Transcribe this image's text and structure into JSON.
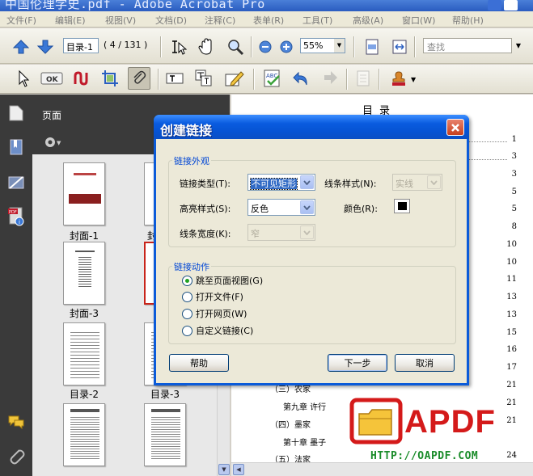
{
  "window": {
    "title": "中国伦理学史.pdf - Adobe Acrobat Pro"
  },
  "menu": [
    "文件(F)",
    "编辑(E)",
    "视图(V)",
    "文档(D)",
    "注释(C)",
    "表单(R)",
    "工具(T)",
    "高级(A)",
    "窗口(W)",
    "帮助(H)"
  ],
  "toolbar": {
    "page_field": "目录-1",
    "page_count": "( 4 / 131 )",
    "zoom": "55%",
    "search_placeholder": "查找"
  },
  "panel": {
    "title": "页面",
    "thumbnails": [
      "封面-1",
      "封",
      "封面-3",
      "",
      "目录-2",
      "目录-3",
      "",
      ""
    ]
  },
  "document": {
    "heading": "目录",
    "page_numbers": [
      "1",
      "3",
      "3",
      "5",
      "5",
      "8",
      "10",
      "10",
      "11",
      "13",
      "13",
      "15",
      "16",
      "17",
      "21",
      "21",
      "21",
      "24"
    ],
    "entries": [
      {
        "text": "（三）农家"
      },
      {
        "text": "第九章  许行"
      },
      {
        "text": "（四）墨家"
      },
      {
        "text": "第十章  墨子"
      },
      {
        "text": "（五）法家"
      }
    ],
    "watermark_brand": "APDF",
    "watermark_url": "HTTP://OAPDF.COM"
  },
  "dialog": {
    "title": "创建链接",
    "appearance_group": "链接外观",
    "link_type_label": "链接类型(T):",
    "link_type_value": "不可见矩形",
    "line_style_label": "线条样式(N):",
    "line_style_value": "实线",
    "highlight_label": "高亮样式(S):",
    "highlight_value": "反色",
    "color_label": "颜色(R):",
    "color_value": "#000000",
    "line_width_label": "线条宽度(K):",
    "line_width_value": "窄",
    "action_group": "链接动作",
    "actions": [
      {
        "label": "跳至页面视图(G)",
        "selected": true
      },
      {
        "label": "打开文件(F)",
        "selected": false
      },
      {
        "label": "打开网页(W)",
        "selected": false
      },
      {
        "label": "自定义链接(C)",
        "selected": false
      }
    ],
    "help_button": "帮助",
    "next_button": "下一步",
    "cancel_button": "取消"
  }
}
